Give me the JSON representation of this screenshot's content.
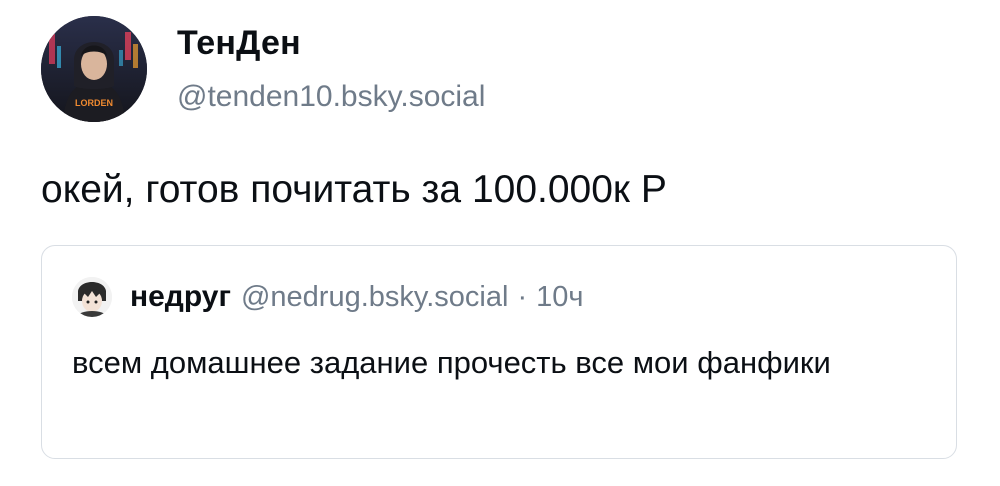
{
  "post": {
    "author": {
      "display_name": "ТенДен",
      "handle": "@tenden10.bsky.social",
      "avatar_icon": "hooded-figure-avatar-icon",
      "avatar_shirt_text": "LORDEN"
    },
    "text": "окей, готов почитать за 100.000к Р",
    "quote": {
      "author": {
        "display_name": "недруг",
        "handle": "@nedrug.bsky.social",
        "avatar_icon": "anime-character-avatar-icon"
      },
      "separator": "·",
      "time": "10ч",
      "text": "всем домашнее задание прочесть все мои фанфики"
    }
  },
  "colors": {
    "text_primary": "#0b0f14",
    "text_secondary": "#6f7b89",
    "card_border": "#d9dee4",
    "background": "#ffffff"
  }
}
